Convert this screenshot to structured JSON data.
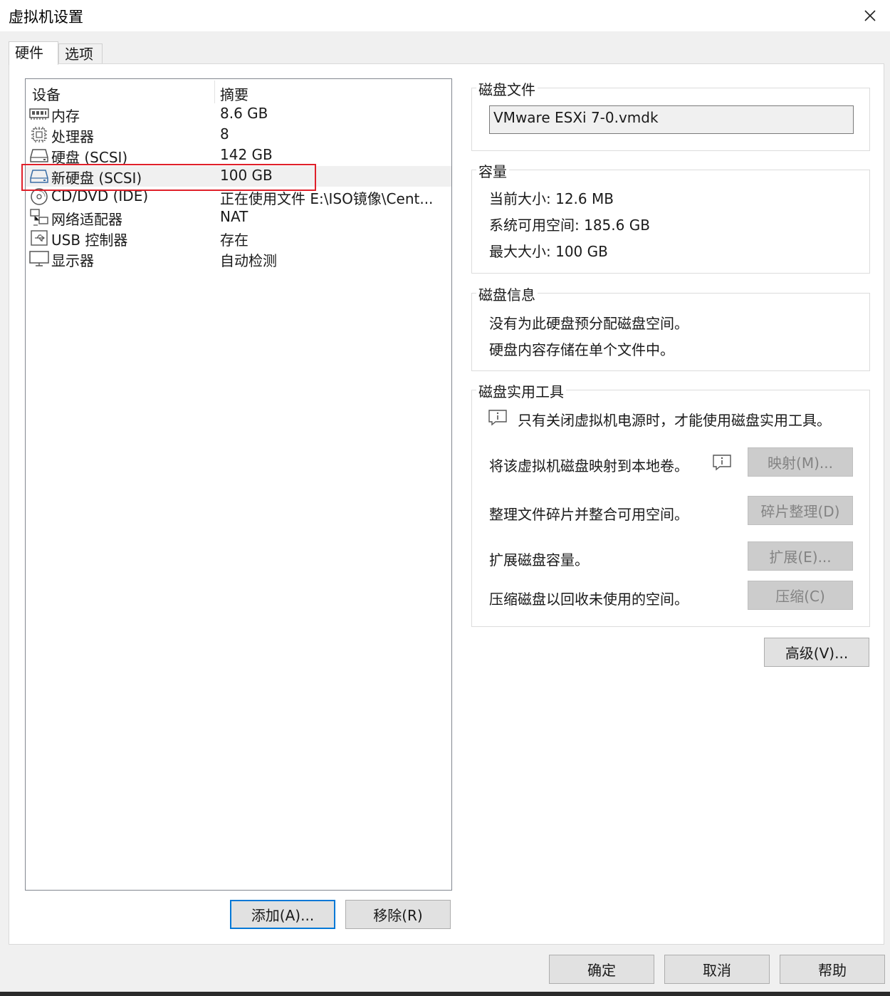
{
  "window": {
    "title": "虚拟机设置"
  },
  "tabs": [
    {
      "label": "硬件"
    },
    {
      "label": "选项"
    }
  ],
  "device_list": {
    "headers": {
      "device": "设备",
      "summary": "摘要"
    },
    "rows": [
      {
        "icon": "memory-icon",
        "name": "内存",
        "summary": "8.6 GB"
      },
      {
        "icon": "processor-icon",
        "name": "处理器",
        "summary": "8"
      },
      {
        "icon": "harddisk-icon",
        "name": "硬盘 (SCSI)",
        "summary": "142 GB"
      },
      {
        "icon": "harddisk-icon",
        "name": "新硬盘 (SCSI)",
        "summary": "100 GB",
        "selected": true
      },
      {
        "icon": "cd-dvd-icon",
        "name": "CD/DVD (IDE)",
        "summary": "正在使用文件 E:\\ISO镜像\\Cent..."
      },
      {
        "icon": "network-adapter-icon",
        "name": "网络适配器",
        "summary": "NAT"
      },
      {
        "icon": "usb-icon",
        "name": "USB 控制器",
        "summary": "存在"
      },
      {
        "icon": "display-icon",
        "name": "显示器",
        "summary": "自动检测"
      }
    ]
  },
  "list_buttons": {
    "add": "添加(A)...",
    "remove": "移除(R)"
  },
  "disk_file": {
    "legend": "磁盘文件",
    "value": "VMware ESXi 7-0.vmdk"
  },
  "capacity": {
    "legend": "容量",
    "current_size": "当前大小: 12.6 MB",
    "free_space": "系统可用空间: 185.6 GB",
    "max_size": "最大大小: 100 GB"
  },
  "disk_info": {
    "legend": "磁盘信息",
    "line1": "没有为此硬盘预分配磁盘空间。",
    "line2": "硬盘内容存储在单个文件中。"
  },
  "disk_utilities": {
    "legend": "磁盘实用工具",
    "notice": "只有关闭虚拟机电源时，才能使用磁盘实用工具。",
    "map_text": "将该虚拟机磁盘映射到本地卷。",
    "map_button": "映射(M)...",
    "defrag_text": "整理文件碎片并整合可用空间。",
    "defrag_button": "碎片整理(D)",
    "expand_text": "扩展磁盘容量。",
    "expand_button": "扩展(E)...",
    "compact_text": "压缩磁盘以回收未使用的空间。",
    "compact_button": "压缩(C)"
  },
  "advanced_button": "高级(V)...",
  "footer": {
    "ok": "确定",
    "cancel": "取消",
    "help": "帮助"
  }
}
